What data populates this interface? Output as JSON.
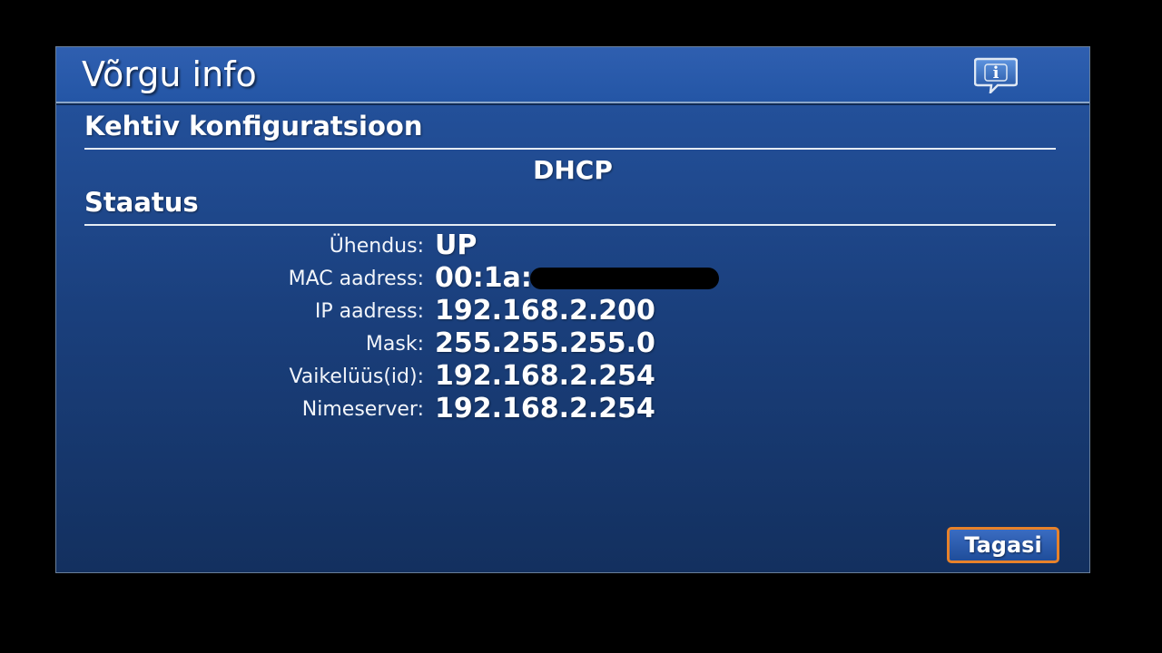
{
  "header": {
    "title": "Võrgu info",
    "info_icon": "info-speech-bubble-icon"
  },
  "configuration": {
    "heading": "Kehtiv konfiguratsioon",
    "mode": "DHCP"
  },
  "status": {
    "heading": "Staatus",
    "rows": [
      {
        "label": "Ühendus:",
        "value": "UP"
      },
      {
        "label": "MAC aadress:",
        "value": "00:1a:"
      },
      {
        "label": "IP aadress:",
        "value": "192.168.2.200"
      },
      {
        "label": "Mask:",
        "value": "255.255.255.0"
      },
      {
        "label": "Vaikelüüs(id):",
        "value": "192.168.2.254"
      },
      {
        "label": "Nimeserver:",
        "value": "192.168.2.254"
      }
    ]
  },
  "footer": {
    "back_label": "Tagasi"
  },
  "colors": {
    "accent_border": "#e8822a",
    "panel_blue": "#23509a",
    "title_blue": "#2f5fb0"
  }
}
